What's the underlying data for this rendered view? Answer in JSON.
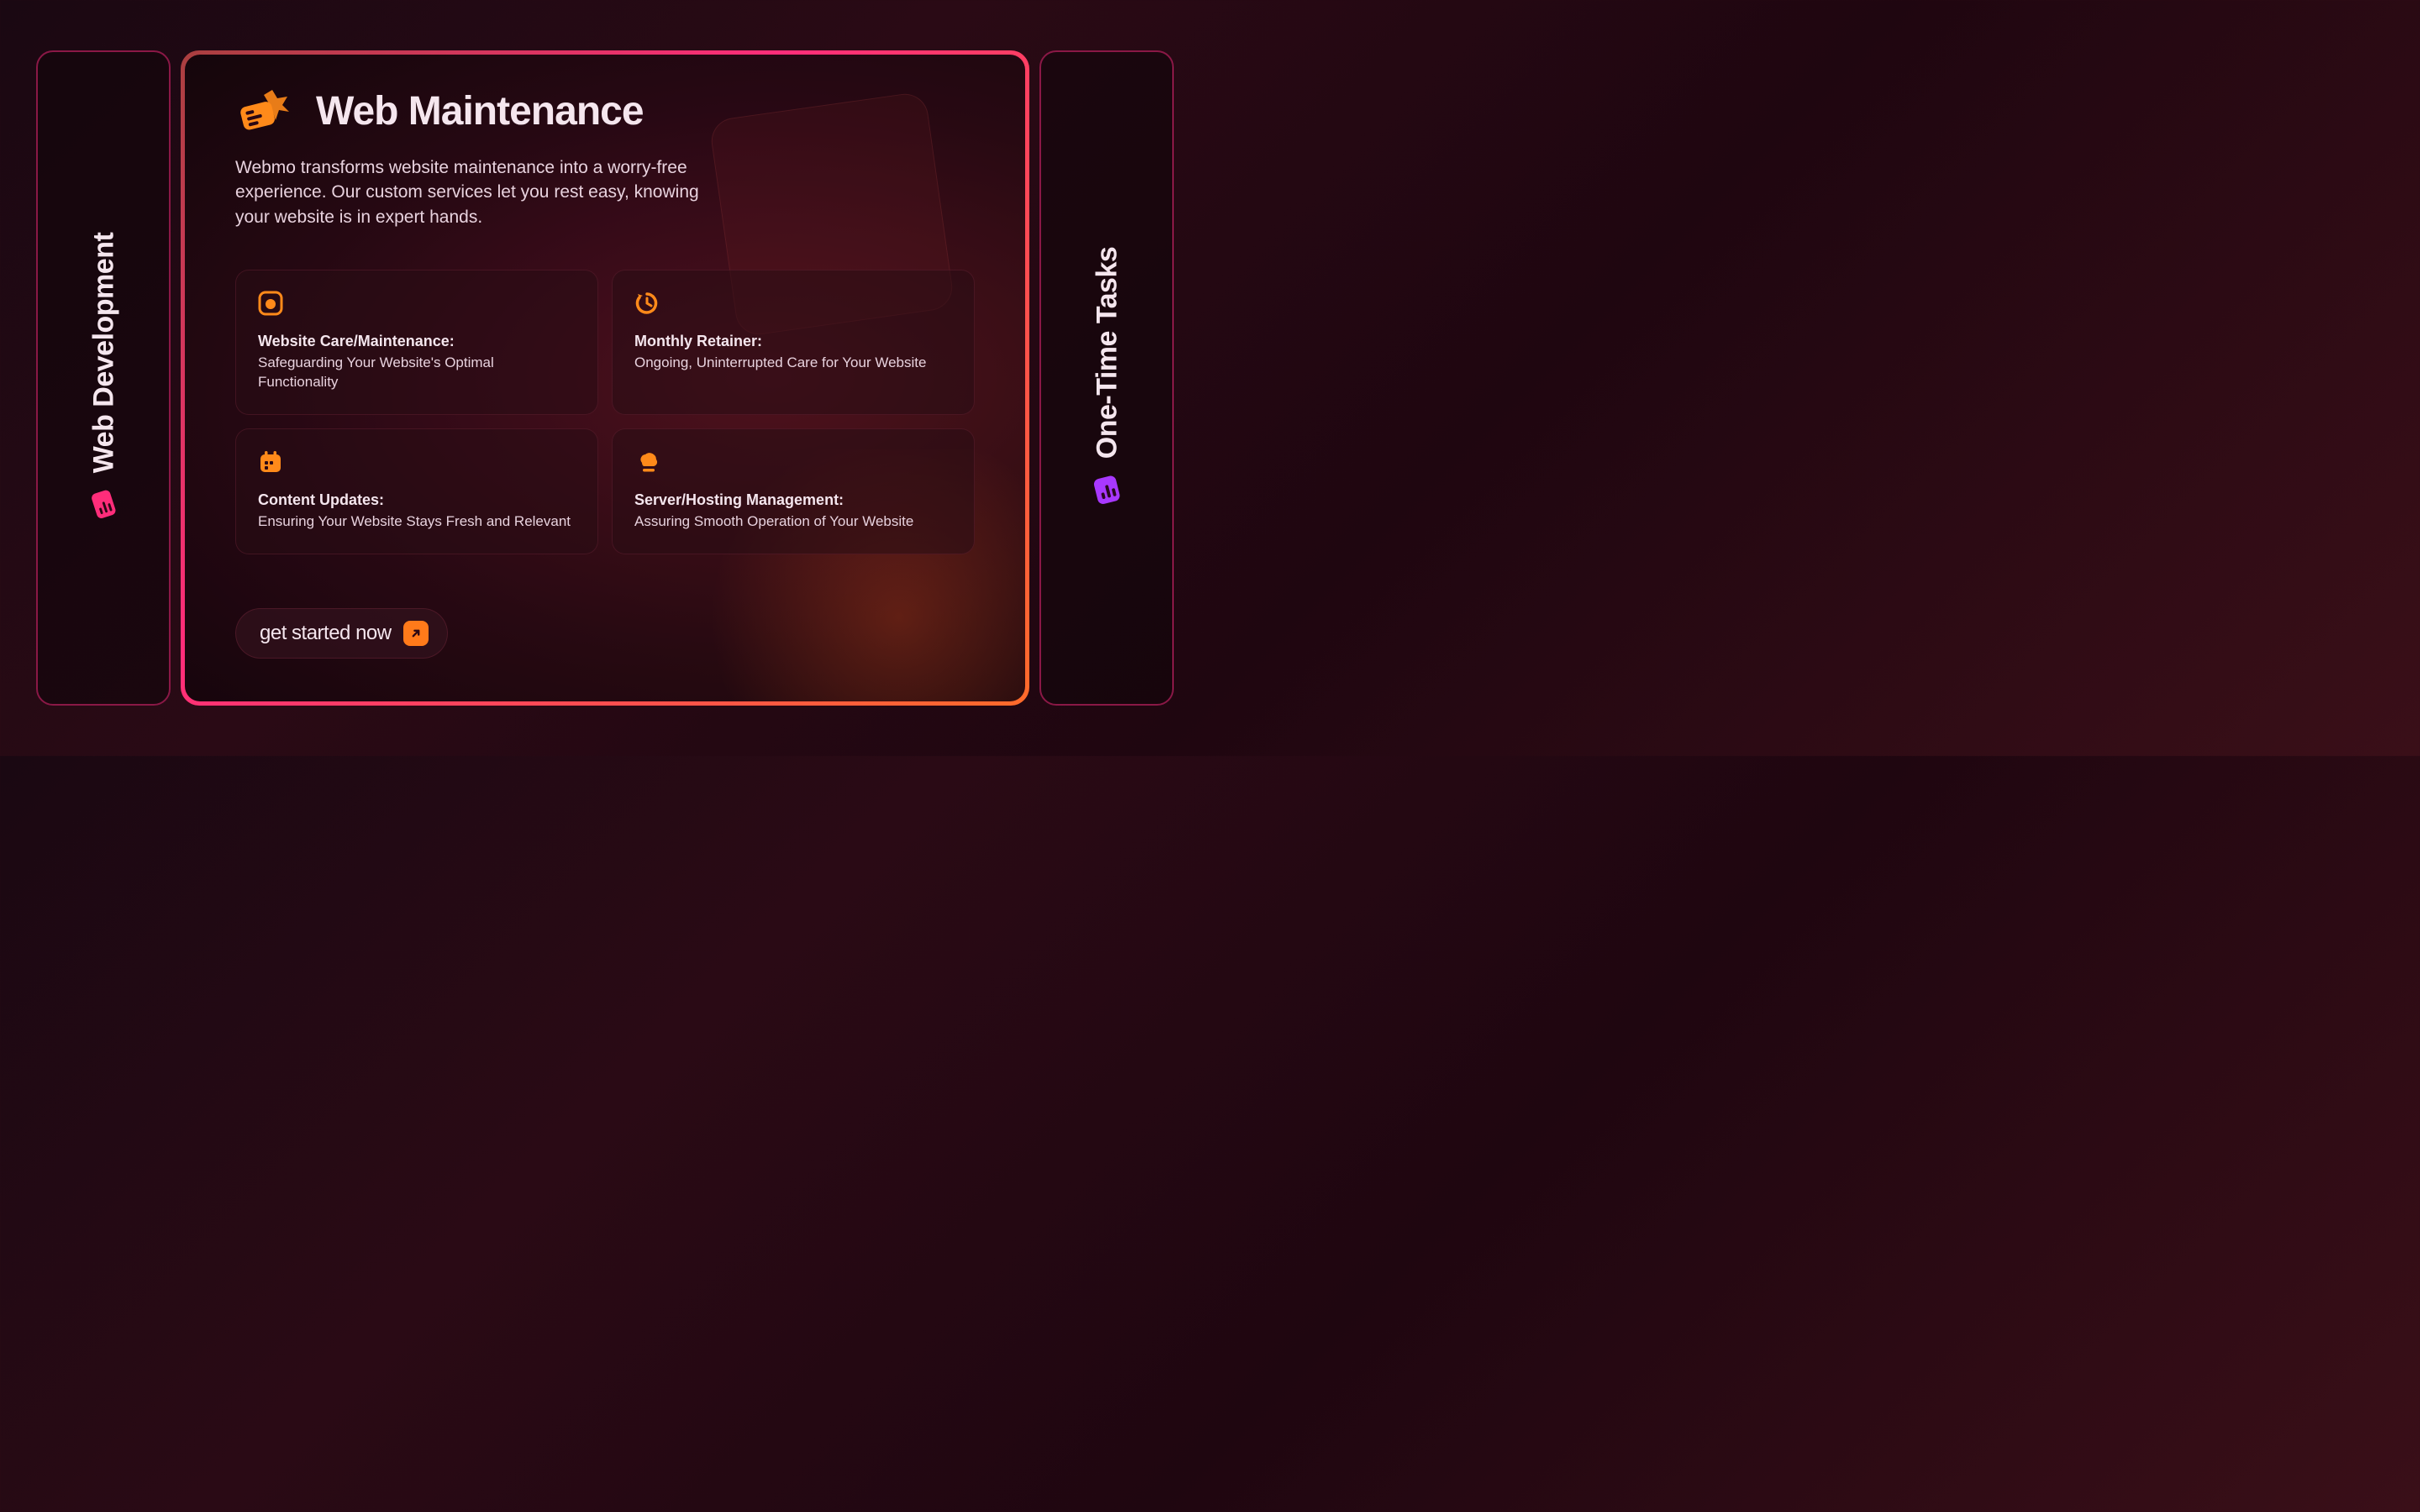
{
  "left_panel": {
    "label": "Web Development"
  },
  "right_panel": {
    "label": "One-Time Tasks"
  },
  "main": {
    "title": "Web Maintenance",
    "description": "Webmo transforms website maintenance into a worry-free experience. Our custom services let you rest easy, knowing your website is in expert hands.",
    "cards": [
      {
        "title": "Website Care/Maintenance:",
        "desc": "Safeguarding Your Website's Optimal Functionality"
      },
      {
        "title": "Monthly Retainer:",
        "desc": "Ongoing, Uninterrupted Care for Your Website"
      },
      {
        "title": "Content Updates:",
        "desc": "Ensuring Your Website Stays Fresh and Relevant"
      },
      {
        "title": "Server/Hosting Management:",
        "desc": "Assuring Smooth Operation of Your Website"
      }
    ],
    "cta": "get started now"
  }
}
